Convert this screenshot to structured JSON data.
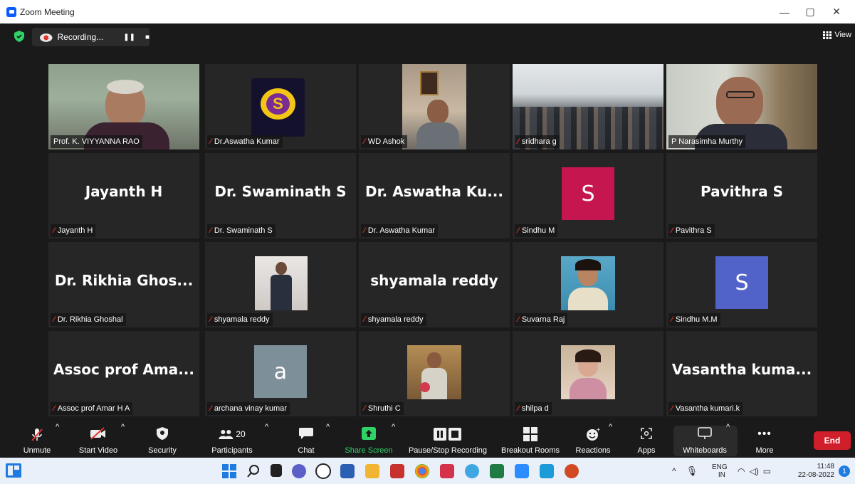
{
  "window": {
    "title": "Zoom Meeting",
    "controls": [
      "—",
      "▢",
      "✕"
    ]
  },
  "recording": {
    "label": "Recording...",
    "pause_icon": "pause-icon",
    "stop_icon": "stop-icon"
  },
  "view_button": {
    "label": "View"
  },
  "participants": [
    {
      "name": "Prof. K. VIYYANNA RAO",
      "type": "photo",
      "muted": false,
      "active": true
    },
    {
      "name": "Dr.Aswatha Kumar",
      "type": "logo",
      "muted": true
    },
    {
      "name": "WD Ashok",
      "type": "photo",
      "muted": true
    },
    {
      "name": "sridhara g",
      "type": "photo",
      "muted": true
    },
    {
      "name": "P Narasimha Murthy",
      "type": "photo",
      "muted": false
    },
    {
      "name": "Jayanth H",
      "display": "Jayanth H",
      "type": "text",
      "muted": true
    },
    {
      "name": "Dr. Swaminath S",
      "display": "Dr. Swaminath S",
      "type": "text",
      "muted": true
    },
    {
      "name": "Dr. Aswatha Kumar",
      "display": "Dr. Aswatha Ku...",
      "type": "text",
      "muted": true
    },
    {
      "name": "Sindhu M",
      "avatar": "S",
      "avatar_color": "#c6164f",
      "type": "avatar",
      "muted": true
    },
    {
      "name": "Pavithra S",
      "display": "Pavithra S",
      "type": "text",
      "muted": true
    },
    {
      "name": "Dr. Rikhia Ghoshal",
      "display": "Dr. Rikhia Ghos...",
      "type": "text",
      "muted": true
    },
    {
      "name": "shyamala reddy",
      "type": "photo",
      "muted": true
    },
    {
      "name": "shyamala reddy",
      "display": "shyamala reddy",
      "type": "text",
      "muted": true
    },
    {
      "name": "Suvarna Raj",
      "type": "photo",
      "muted": true
    },
    {
      "name": "Sindhu M.M",
      "avatar": "S",
      "avatar_color": "#5163c9",
      "type": "avatar",
      "muted": true
    },
    {
      "name": "Assoc prof Amar H A",
      "display": "Assoc prof Ama...",
      "type": "text",
      "muted": true
    },
    {
      "name": "archana vinay kumar",
      "avatar": "a",
      "avatar_color": "#7d8f99",
      "type": "avatar",
      "muted": true
    },
    {
      "name": "Shruthi C",
      "type": "photo",
      "muted": true
    },
    {
      "name": "shilpa d",
      "type": "photo",
      "muted": true
    },
    {
      "name": "Vasantha kumari.k",
      "display": "Vasantha  kuma...",
      "type": "text",
      "muted": true
    }
  ],
  "toolbar": {
    "unmute": "Unmute",
    "start_video": "Start Video",
    "security": "Security",
    "participants": "Participants",
    "participants_count": "20",
    "chat": "Chat",
    "share_screen": "Share Screen",
    "pause_stop_recording": "Pause/Stop Recording",
    "breakout_rooms": "Breakout Rooms",
    "reactions": "Reactions",
    "apps": "Apps",
    "whiteboards": "Whiteboards",
    "more": "More",
    "end": "End"
  },
  "taskbar": {
    "lang_top": "ENG",
    "lang_bottom": "IN",
    "time": "11:48",
    "date": "22-08-2022",
    "notifications": "1"
  },
  "colors": {
    "accent_green": "#2fd267",
    "end_red": "#d11e2b",
    "active_border": "#d5e86c",
    "mute_red": "#e2322b"
  }
}
